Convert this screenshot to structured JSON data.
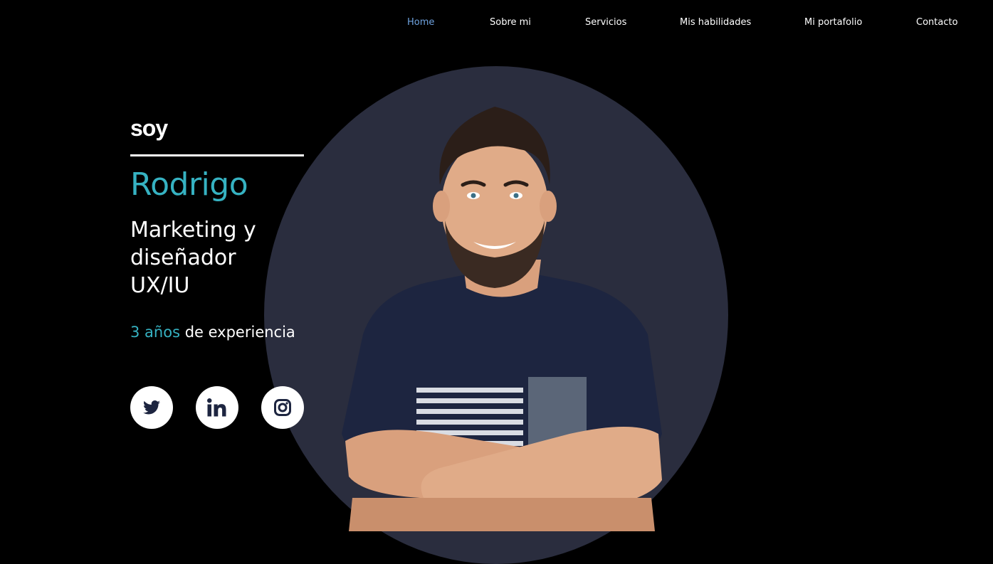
{
  "nav": {
    "items": [
      {
        "label": "Home",
        "active": true
      },
      {
        "label": "Sobre mi",
        "active": false
      },
      {
        "label": "Servicios",
        "active": false
      },
      {
        "label": "Mis habilidades",
        "active": false
      },
      {
        "label": "Mi portafolio",
        "active": false
      },
      {
        "label": "Contacto",
        "active": false
      }
    ]
  },
  "hero": {
    "greeting": "soy",
    "name": "Rodrigo",
    "role": "Marketing y diseñador UX/IU",
    "experience_highlight": "3 años",
    "experience_rest": " de experiencia"
  },
  "social": [
    {
      "icon": "twitter-icon"
    },
    {
      "icon": "linkedin-icon"
    },
    {
      "icon": "instagram-icon"
    }
  ],
  "colors": {
    "background": "#000000",
    "accent": "#36b2c2",
    "nav_active": "#6fa3e0",
    "circle": "#2a2d3e"
  }
}
